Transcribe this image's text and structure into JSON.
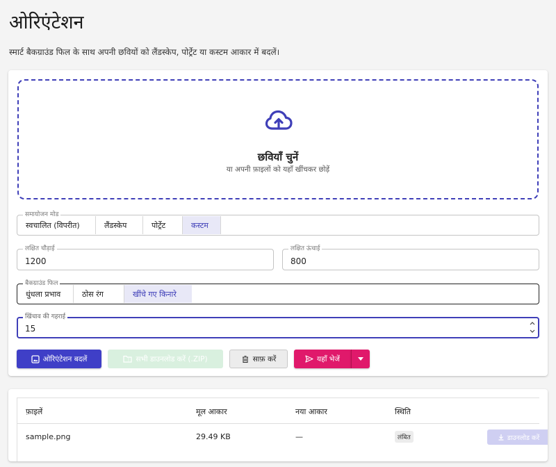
{
  "header": {
    "title": "ओरिएंटेशन",
    "subtitle": "स्मार्ट बैकग्राउंड फिल के साथ अपनी छवियों को लैंडस्केप, पोर्ट्रेट या कस्टम आकार में बदलें।"
  },
  "dropzone": {
    "icon": "cloud-upload-icon",
    "title": "छवियाँ चुनें",
    "hint": "या अपनी फ़ाइलों को यहाँ खींचकर छोड़ें"
  },
  "mode": {
    "label": "समायोजन मोड",
    "options": [
      "स्वचालित (विपरीत)",
      "लैंडस्केप",
      "पोर्ट्रेट",
      "कस्टम"
    ],
    "selected": "कस्टम"
  },
  "target_width": {
    "label": "लक्षित चौड़ाई",
    "value": "1200"
  },
  "target_height": {
    "label": "लक्षित ऊंचाई",
    "value": "800"
  },
  "background": {
    "label": "बैकग्राउंड फिल",
    "options": [
      "धुंधला प्रभाव",
      "ठोस रंग",
      "खींचे गए किनारे"
    ],
    "selected": "खींचे गए किनारे"
  },
  "stretch_depth": {
    "label": "खिंचाव की गहराई",
    "value": "15"
  },
  "actions": {
    "convert_label": "ओरिएंटेशन बदलें",
    "download_all_label": "सभी डाउनलोड करें (.ZIP)",
    "clear_label": "साफ़ करें",
    "send_label": "यहाँ भेजें"
  },
  "table": {
    "headers": [
      "फ़ाइलें",
      "मूल आकार",
      "नया आकार",
      "स्थिति"
    ],
    "rows": [
      {
        "file": "sample.png",
        "original_size": "29.49 KB",
        "new_size": "—",
        "status": "लंबित",
        "download_label": "डाउनलोड करें"
      }
    ]
  },
  "colors": {
    "accent": "#3f3fc7",
    "send": "#e0196b",
    "download_disabled": "#d9f0df"
  }
}
